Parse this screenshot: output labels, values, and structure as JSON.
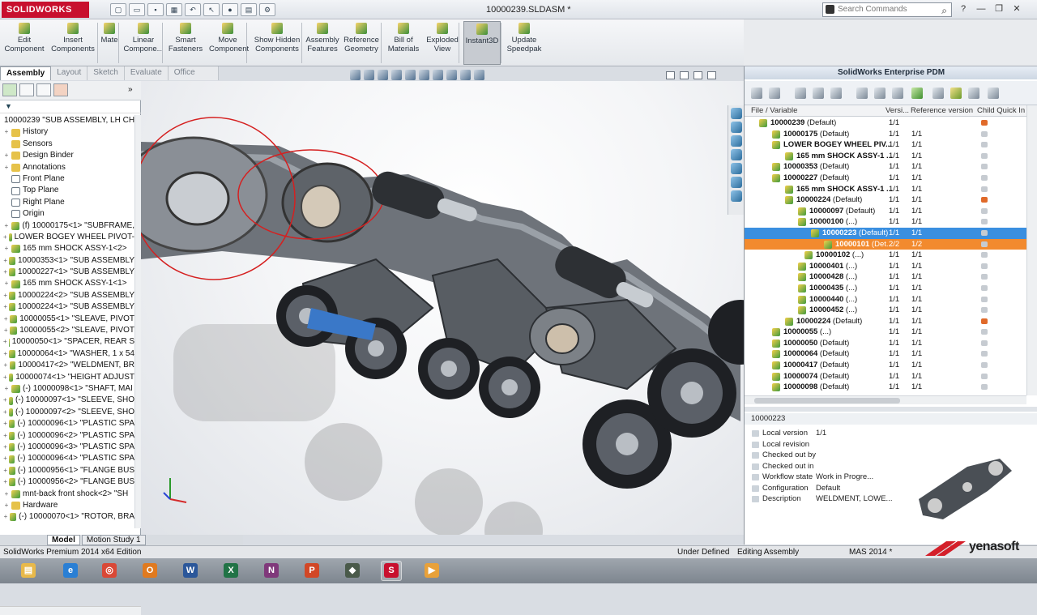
{
  "app": {
    "brand": "SOLIDWORKS",
    "title": "10000239.SLDASM *",
    "search_placeholder": "Search Commands"
  },
  "commands": [
    {
      "label": "Edit Component"
    },
    {
      "label": "Insert Components"
    },
    {
      "label": "Mate"
    },
    {
      "label": "Linear Compone..."
    },
    {
      "label": "Smart Fasteners"
    },
    {
      "label": "Move Component"
    },
    {
      "label": "Show Hidden Components"
    },
    {
      "label": "Assembly Features"
    },
    {
      "label": "Reference Geometry"
    },
    {
      "label": "Bill of Materials"
    },
    {
      "label": "Exploded View"
    },
    {
      "label": "Instant3D"
    },
    {
      "label": "Update Speedpak"
    }
  ],
  "tabs": [
    "Assembly",
    "Layout",
    "Sketch",
    "Evaluate",
    "Office Products"
  ],
  "tree": [
    {
      "text": "10000239 \"SUB ASSEMBLY, LH CH",
      "icon": "asm",
      "toggle": ""
    },
    {
      "text": "History",
      "icon": "fold",
      "toggle": "+"
    },
    {
      "text": "Sensors",
      "icon": "fold",
      "toggle": ""
    },
    {
      "text": "Design Binder",
      "icon": "fold",
      "toggle": "+"
    },
    {
      "text": "Annotations",
      "icon": "fold",
      "toggle": "+"
    },
    {
      "text": "Front Plane",
      "icon": "plane",
      "toggle": ""
    },
    {
      "text": "Top Plane",
      "icon": "plane",
      "toggle": ""
    },
    {
      "text": "Right Plane",
      "icon": "plane",
      "toggle": ""
    },
    {
      "text": "Origin",
      "icon": "plane",
      "toggle": ""
    },
    {
      "text": "(f) 10000175<1> \"SUBFRAME,",
      "icon": "asm",
      "toggle": "+"
    },
    {
      "text": "LOWER BOGEY WHEEL PIVOT-",
      "icon": "asm",
      "toggle": "+"
    },
    {
      "text": "165 mm SHOCK ASSY-1<2>",
      "icon": "asm",
      "toggle": "+"
    },
    {
      "text": "10000353<1> \"SUB ASSEMBLY",
      "icon": "asm",
      "toggle": "+"
    },
    {
      "text": "10000227<1> \"SUB ASSEMBLY",
      "icon": "asm",
      "toggle": "+"
    },
    {
      "text": "165 mm SHOCK ASSY-1<1>",
      "icon": "asm",
      "toggle": "+"
    },
    {
      "text": "10000224<2> \"SUB ASSEMBLY",
      "icon": "asm",
      "toggle": "+"
    },
    {
      "text": "10000224<1> \"SUB ASSEMBLY",
      "icon": "asm",
      "toggle": "+"
    },
    {
      "text": "10000055<1> \"SLEAVE, PIVOT",
      "icon": "asm",
      "toggle": "+"
    },
    {
      "text": "10000055<2> \"SLEAVE, PIVOT",
      "icon": "asm",
      "toggle": "+"
    },
    {
      "text": "10000050<1> \"SPACER, REAR S",
      "icon": "asm",
      "toggle": "+"
    },
    {
      "text": "10000064<1> \"WASHER, 1 x 54",
      "icon": "asm",
      "toggle": "+"
    },
    {
      "text": "10000417<2> \"WELDMENT, BR",
      "icon": "asm",
      "toggle": "+"
    },
    {
      "text": "10000074<1> \"HEIGHT ADJUST",
      "icon": "asm",
      "toggle": "+"
    },
    {
      "text": "(-) 10000098<1> \"SHAFT, MAI",
      "icon": "asm",
      "toggle": "+"
    },
    {
      "text": "(-) 10000097<1> \"SLEEVE, SHO",
      "icon": "asm",
      "toggle": "+"
    },
    {
      "text": "(-) 10000097<2> \"SLEEVE, SHO",
      "icon": "asm",
      "toggle": "+"
    },
    {
      "text": "(-) 10000096<1> \"PLASTIC SPA",
      "icon": "asm",
      "toggle": "+"
    },
    {
      "text": "(-) 10000096<2> \"PLASTIC SPA",
      "icon": "asm",
      "toggle": "+"
    },
    {
      "text": "(-) 10000096<3> \"PLASTIC SPA",
      "icon": "asm",
      "toggle": "+"
    },
    {
      "text": "(-) 10000096<4> \"PLASTIC SPA",
      "icon": "asm",
      "toggle": "+"
    },
    {
      "text": "(-) 10000956<1> \"FLANGE BUS",
      "icon": "asm",
      "toggle": "+"
    },
    {
      "text": "(-) 10000956<2> \"FLANGE BUS",
      "icon": "asm",
      "toggle": "+"
    },
    {
      "text": "mnt-back front shock<2> \"SH",
      "icon": "asm",
      "toggle": "+"
    },
    {
      "text": "Hardware",
      "icon": "fold",
      "toggle": "+"
    },
    {
      "text": "(-) 10000070<1> \"ROTOR, BRA",
      "icon": "asm",
      "toggle": "+"
    }
  ],
  "bottom_tabs": [
    "Model",
    "Motion Study 1"
  ],
  "pdm": {
    "title": "SolidWorks Enterprise PDM",
    "columns": [
      "File / Variable",
      "Versi...",
      "Reference version",
      "Child Quick In"
    ],
    "rows": [
      {
        "name": "10000239",
        "cfg": "(Default)",
        "lv": "1/1",
        "rv": "",
        "ind": 10,
        "q": "warn",
        "style": ""
      },
      {
        "name": "10000175",
        "cfg": "(Default)",
        "lv": "1/1",
        "rv": "1/1",
        "ind": 26,
        "q": "",
        "style": ""
      },
      {
        "name": "LOWER BOGEY WHEEL PIV...",
        "cfg": "",
        "lv": "1/1",
        "rv": "1/1",
        "ind": 26,
        "q": "",
        "style": ""
      },
      {
        "name": "165 mm SHOCK ASSY-1 ...",
        "cfg": "",
        "lv": "1/1",
        "rv": "1/1",
        "ind": 42,
        "q": "",
        "style": ""
      },
      {
        "name": "10000353",
        "cfg": "(Default)",
        "lv": "1/1",
        "rv": "1/1",
        "ind": 26,
        "q": "",
        "style": ""
      },
      {
        "name": "10000227",
        "cfg": "(Default)",
        "lv": "1/1",
        "rv": "1/1",
        "ind": 26,
        "q": "",
        "style": ""
      },
      {
        "name": "165 mm SHOCK ASSY-1 ...",
        "cfg": "",
        "lv": "1/1",
        "rv": "1/1",
        "ind": 42,
        "q": "",
        "style": ""
      },
      {
        "name": "10000224",
        "cfg": "(Default)",
        "lv": "1/1",
        "rv": "1/1",
        "ind": 42,
        "q": "warn",
        "style": ""
      },
      {
        "name": "10000097",
        "cfg": "(Default)",
        "lv": "1/1",
        "rv": "1/1",
        "ind": 58,
        "q": "",
        "style": ""
      },
      {
        "name": "10000100",
        "cfg": "(...)",
        "lv": "1/1",
        "rv": "1/1",
        "ind": 58,
        "q": "",
        "style": ""
      },
      {
        "name": "10000223",
        "cfg": "(Default)",
        "lv": "1/1",
        "rv": "1/1",
        "ind": 74,
        "q": "",
        "style": "sel"
      },
      {
        "name": "10000101",
        "cfg": "(Det...",
        "lv": "2/2",
        "rv": "1/2",
        "ind": 90,
        "q": "",
        "style": "orng"
      },
      {
        "name": "10000102",
        "cfg": "(...)",
        "lv": "1/1",
        "rv": "1/1",
        "ind": 66,
        "q": "",
        "style": ""
      },
      {
        "name": "10000401",
        "cfg": "(...)",
        "lv": "1/1",
        "rv": "1/1",
        "ind": 58,
        "q": "",
        "style": ""
      },
      {
        "name": "10000428",
        "cfg": "(...)",
        "lv": "1/1",
        "rv": "1/1",
        "ind": 58,
        "q": "",
        "style": ""
      },
      {
        "name": "10000435",
        "cfg": "(...)",
        "lv": "1/1",
        "rv": "1/1",
        "ind": 58,
        "q": "",
        "style": ""
      },
      {
        "name": "10000440",
        "cfg": "(...)",
        "lv": "1/1",
        "rv": "1/1",
        "ind": 58,
        "q": "",
        "style": ""
      },
      {
        "name": "10000452",
        "cfg": "(...)",
        "lv": "1/1",
        "rv": "1/1",
        "ind": 58,
        "q": "",
        "style": ""
      },
      {
        "name": "10000224",
        "cfg": "(Default)",
        "lv": "1/1",
        "rv": "1/1",
        "ind": 42,
        "q": "warn",
        "style": ""
      },
      {
        "name": "10000055",
        "cfg": "(...)",
        "lv": "1/1",
        "rv": "1/1",
        "ind": 26,
        "q": "",
        "style": ""
      },
      {
        "name": "10000050",
        "cfg": "(Default)",
        "lv": "1/1",
        "rv": "1/1",
        "ind": 26,
        "q": "",
        "style": ""
      },
      {
        "name": "10000064",
        "cfg": "(Default)",
        "lv": "1/1",
        "rv": "1/1",
        "ind": 26,
        "q": "",
        "style": ""
      },
      {
        "name": "10000417",
        "cfg": "(Default)",
        "lv": "1/1",
        "rv": "1/1",
        "ind": 26,
        "q": "",
        "style": ""
      },
      {
        "name": "10000074",
        "cfg": "(Default)",
        "lv": "1/1",
        "rv": "1/1",
        "ind": 26,
        "q": "",
        "style": ""
      },
      {
        "name": "10000098",
        "cfg": "(Default)",
        "lv": "1/1",
        "rv": "1/1",
        "ind": 26,
        "q": "",
        "style": ""
      }
    ],
    "selected_file": "10000223",
    "props": [
      {
        "k": "Local version",
        "v": "1/1"
      },
      {
        "k": "Local revision",
        "v": ""
      },
      {
        "k": "Checked out by",
        "v": ""
      },
      {
        "k": "Checked out in",
        "v": ""
      },
      {
        "k": "Workflow state",
        "v": "Work in Progre..."
      },
      {
        "k": "Configuration",
        "v": "Default"
      },
      {
        "k": "Description",
        "v": "WELDMENT, LOWE..."
      }
    ]
  },
  "status": {
    "edition": "SolidWorks Premium 2014 x64 Edition",
    "defined": "Under Defined",
    "mode": "Editing Assembly",
    "units": "MAS 2014 *"
  },
  "watermark": "yenasoft",
  "taskbar": [
    {
      "icon": "file-explorer-icon",
      "color": "#e8b94a",
      "glyph": "▤"
    },
    {
      "icon": "internet-explorer-icon",
      "color": "#2a7fd4",
      "glyph": "e"
    },
    {
      "icon": "chrome-icon",
      "color": "#d94836",
      "glyph": "◎"
    },
    {
      "icon": "outlook-icon",
      "color": "#e07a1f",
      "glyph": "O"
    },
    {
      "icon": "word-icon",
      "color": "#2b579a",
      "glyph": "W"
    },
    {
      "icon": "excel-icon",
      "color": "#217346",
      "glyph": "X"
    },
    {
      "icon": "onenote-icon",
      "color": "#80397b",
      "glyph": "N"
    },
    {
      "icon": "powerpoint-icon",
      "color": "#d24726",
      "glyph": "P"
    },
    {
      "icon": "pdm-icon",
      "color": "#4a5a4a",
      "glyph": "◆"
    },
    {
      "icon": "solidworks-icon",
      "color": "#c8102e",
      "glyph": "S"
    },
    {
      "icon": "media-player-icon",
      "color": "#e8a13a",
      "glyph": "▶"
    }
  ]
}
